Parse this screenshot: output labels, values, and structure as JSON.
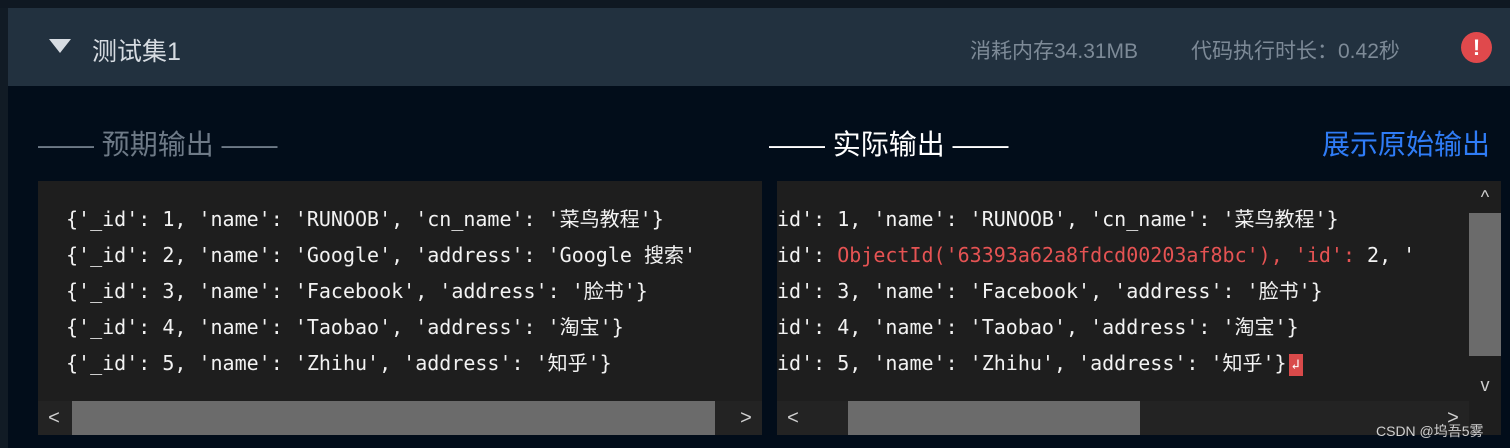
{
  "test_suite": {
    "title": "测试集1",
    "memory": "消耗内存34.31MB",
    "duration": "代码执行时长：0.42秒",
    "alert_symbol": "!"
  },
  "labels": {
    "expected": "—— 预期输出 ——",
    "actual": "—— 实际输出 ——",
    "raw_output_link": "展示原始输出"
  },
  "expected_output": [
    "{'_id': 1, 'name': 'RUNOOB', 'cn_name': '菜鸟教程'}",
    "{'_id': 2, 'name': 'Google', 'address': 'Google 搜索'",
    "{'_id': 3, 'name': 'Facebook', 'address': '脸书'}",
    "{'_id': 4, 'name': 'Taobao', 'address': '淘宝'}",
    "{'_id': 5, 'name': 'Zhihu', 'address': '知乎'}"
  ],
  "actual_output": {
    "line1": "id': 1, 'name': 'RUNOOB', 'cn_name': '菜鸟教程'}",
    "line2_prefix": "id': ",
    "line2_diff": "ObjectId('63393a62a8fdcd00203af8bc'), 'id':",
    "line2_suffix": " 2, '",
    "line3": "id': 3, 'name': 'Facebook', 'address': '脸书'}",
    "line4": "id': 4, 'name': 'Taobao', 'address': '淘宝'}",
    "line5": "id': 5, 'name': 'Zhihu', 'address': '知乎'}",
    "newline_marker": "↲"
  },
  "scroll_arrows": {
    "left": "<",
    "right": ">",
    "up": "^",
    "down": "v"
  },
  "watermark": "CSDN @坞吾5雾"
}
